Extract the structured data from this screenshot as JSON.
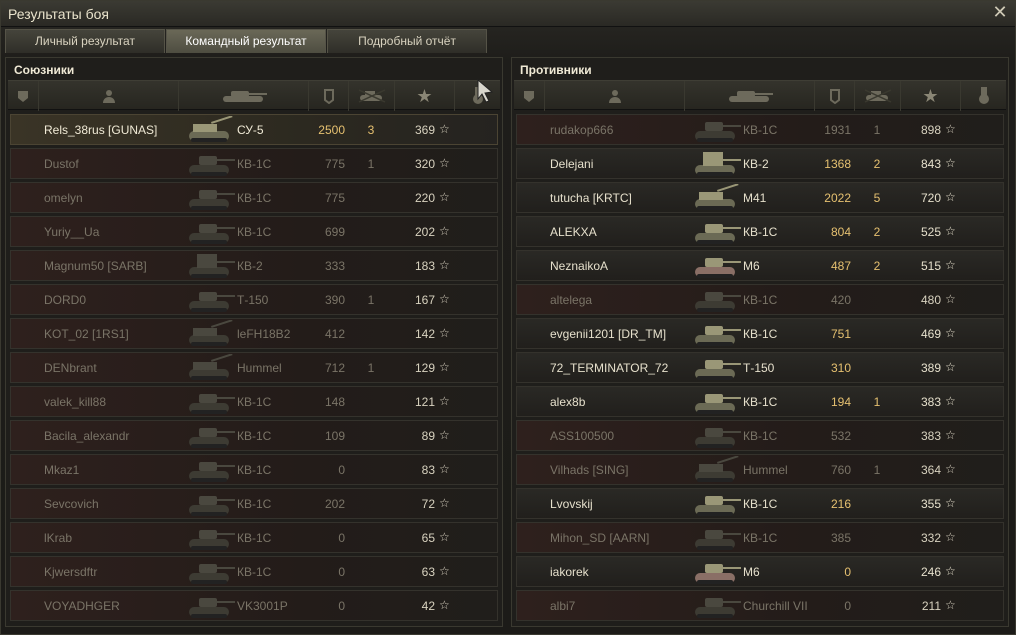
{
  "window": {
    "title": "Результаты боя"
  },
  "tabs": [
    {
      "label": "Личный результат",
      "active": false
    },
    {
      "label": "Командный результат",
      "active": true
    },
    {
      "label": "Подробный отчёт",
      "active": false
    }
  ],
  "allies": {
    "title": "Союзники",
    "rows": [
      {
        "name": "Rels_38rus [GUNAS]",
        "vehicle": "СУ-5",
        "damage": "2500",
        "kills": "3",
        "xp": "369",
        "state": "player",
        "tank": "spg"
      },
      {
        "name": "Dustof",
        "vehicle": "КВ-1С",
        "damage": "775",
        "kills": "1",
        "xp": "320",
        "state": "dead",
        "tank": "heavy"
      },
      {
        "name": "omelyn",
        "vehicle": "КВ-1С",
        "damage": "775",
        "kills": "",
        "xp": "220",
        "state": "dead",
        "tank": "heavy"
      },
      {
        "name": "Yuriy__Ua",
        "vehicle": "КВ-1С",
        "damage": "699",
        "kills": "",
        "xp": "202",
        "state": "dead",
        "tank": "heavy"
      },
      {
        "name": "Magnum50 [SARB]",
        "vehicle": "КВ-2",
        "damage": "333",
        "kills": "",
        "xp": "183",
        "state": "dead",
        "tank": "kv2"
      },
      {
        "name": "DORD0",
        "vehicle": "Т-150",
        "damage": "390",
        "kills": "1",
        "xp": "167",
        "state": "dead",
        "tank": "heavy"
      },
      {
        "name": "KOT_02 [1RS1]",
        "vehicle": "leFH18B2",
        "damage": "412",
        "kills": "",
        "xp": "142",
        "state": "dead",
        "tank": "spg"
      },
      {
        "name": "DENbrant",
        "vehicle": "Hummel",
        "damage": "712",
        "kills": "1",
        "xp": "129",
        "state": "dead",
        "tank": "spg"
      },
      {
        "name": "valek_kill88",
        "vehicle": "КВ-1С",
        "damage": "148",
        "kills": "",
        "xp": "121",
        "state": "dead",
        "tank": "heavy"
      },
      {
        "name": "Bacila_alexandr",
        "vehicle": "КВ-1С",
        "damage": "109",
        "kills": "",
        "xp": "89",
        "state": "dead",
        "tank": "heavy"
      },
      {
        "name": "Mkaz1",
        "vehicle": "КВ-1С",
        "damage": "0",
        "kills": "",
        "xp": "83",
        "state": "dead",
        "tank": "heavy"
      },
      {
        "name": "Sevcovich",
        "vehicle": "КВ-1С",
        "damage": "202",
        "kills": "",
        "xp": "72",
        "state": "dead",
        "tank": "heavy"
      },
      {
        "name": "lKrab",
        "vehicle": "КВ-1С",
        "damage": "0",
        "kills": "",
        "xp": "65",
        "state": "dead",
        "tank": "heavy"
      },
      {
        "name": "Kjwersdftr",
        "vehicle": "КВ-1С",
        "damage": "0",
        "kills": "",
        "xp": "63",
        "state": "dead",
        "tank": "heavy"
      },
      {
        "name": "VOYADHGER",
        "vehicle": "VK3001P",
        "damage": "0",
        "kills": "",
        "xp": "42",
        "state": "dead",
        "tank": "medium"
      }
    ]
  },
  "enemies": {
    "title": "Противники",
    "rows": [
      {
        "name": "rudakop666",
        "vehicle": "КВ-1С",
        "damage": "1931",
        "kills": "1",
        "xp": "898",
        "state": "dead",
        "tank": "heavy"
      },
      {
        "name": "Delejani",
        "vehicle": "КВ-2",
        "damage": "1368",
        "kills": "2",
        "xp": "843",
        "state": "alive",
        "tank": "kv2"
      },
      {
        "name": "tutucha [KRTC]",
        "vehicle": "M41",
        "damage": "2022",
        "kills": "5",
        "xp": "720",
        "state": "alive",
        "tank": "spg"
      },
      {
        "name": "ALEKXA",
        "vehicle": "КВ-1С",
        "damage": "804",
        "kills": "2",
        "xp": "525",
        "state": "alive",
        "tank": "heavy"
      },
      {
        "name": "NeznaikoA",
        "vehicle": "M6",
        "damage": "487",
        "kills": "2",
        "xp": "515",
        "state": "alive",
        "tank": "m6"
      },
      {
        "name": "altelega",
        "vehicle": "КВ-1С",
        "damage": "420",
        "kills": "",
        "xp": "480",
        "state": "dead",
        "tank": "heavy"
      },
      {
        "name": "evgenii1201 [DR_TM]",
        "vehicle": "КВ-1С",
        "damage": "751",
        "kills": "",
        "xp": "469",
        "state": "alive",
        "tank": "heavy"
      },
      {
        "name": "72_TERMINATOR_72",
        "vehicle": "Т-150",
        "damage": "310",
        "kills": "",
        "xp": "389",
        "state": "alive",
        "tank": "heavy"
      },
      {
        "name": "alex8b",
        "vehicle": "КВ-1С",
        "damage": "194",
        "kills": "1",
        "xp": "383",
        "state": "alive",
        "tank": "heavy"
      },
      {
        "name": "ASS100500",
        "vehicle": "КВ-1С",
        "damage": "532",
        "kills": "",
        "xp": "383",
        "state": "dead",
        "tank": "heavy"
      },
      {
        "name": "Vilhads [SING]",
        "vehicle": "Hummel",
        "damage": "760",
        "kills": "1",
        "xp": "364",
        "state": "dead",
        "tank": "spg"
      },
      {
        "name": "Lvovskij",
        "vehicle": "КВ-1С",
        "damage": "216",
        "kills": "",
        "xp": "355",
        "state": "alive",
        "tank": "heavy"
      },
      {
        "name": "Mihon_SD [AARN]",
        "vehicle": "КВ-1С",
        "damage": "385",
        "kills": "",
        "xp": "332",
        "state": "dead",
        "tank": "heavy"
      },
      {
        "name": "iakorek",
        "vehicle": "M6",
        "damage": "0",
        "kills": "",
        "xp": "246",
        "state": "alive",
        "tank": "m6"
      },
      {
        "name": "albi7",
        "vehicle": "Churchill VII",
        "damage": "0",
        "kills": "",
        "xp": "211",
        "state": "dead",
        "tank": "churchill"
      }
    ]
  },
  "columns": [
    "squad-icon",
    "player-icon",
    "vehicle-icon",
    "damage-icon",
    "kills-icon",
    "xp-icon",
    "medal-icon"
  ],
  "icons": {
    "star": "☆",
    "close": "✕"
  }
}
